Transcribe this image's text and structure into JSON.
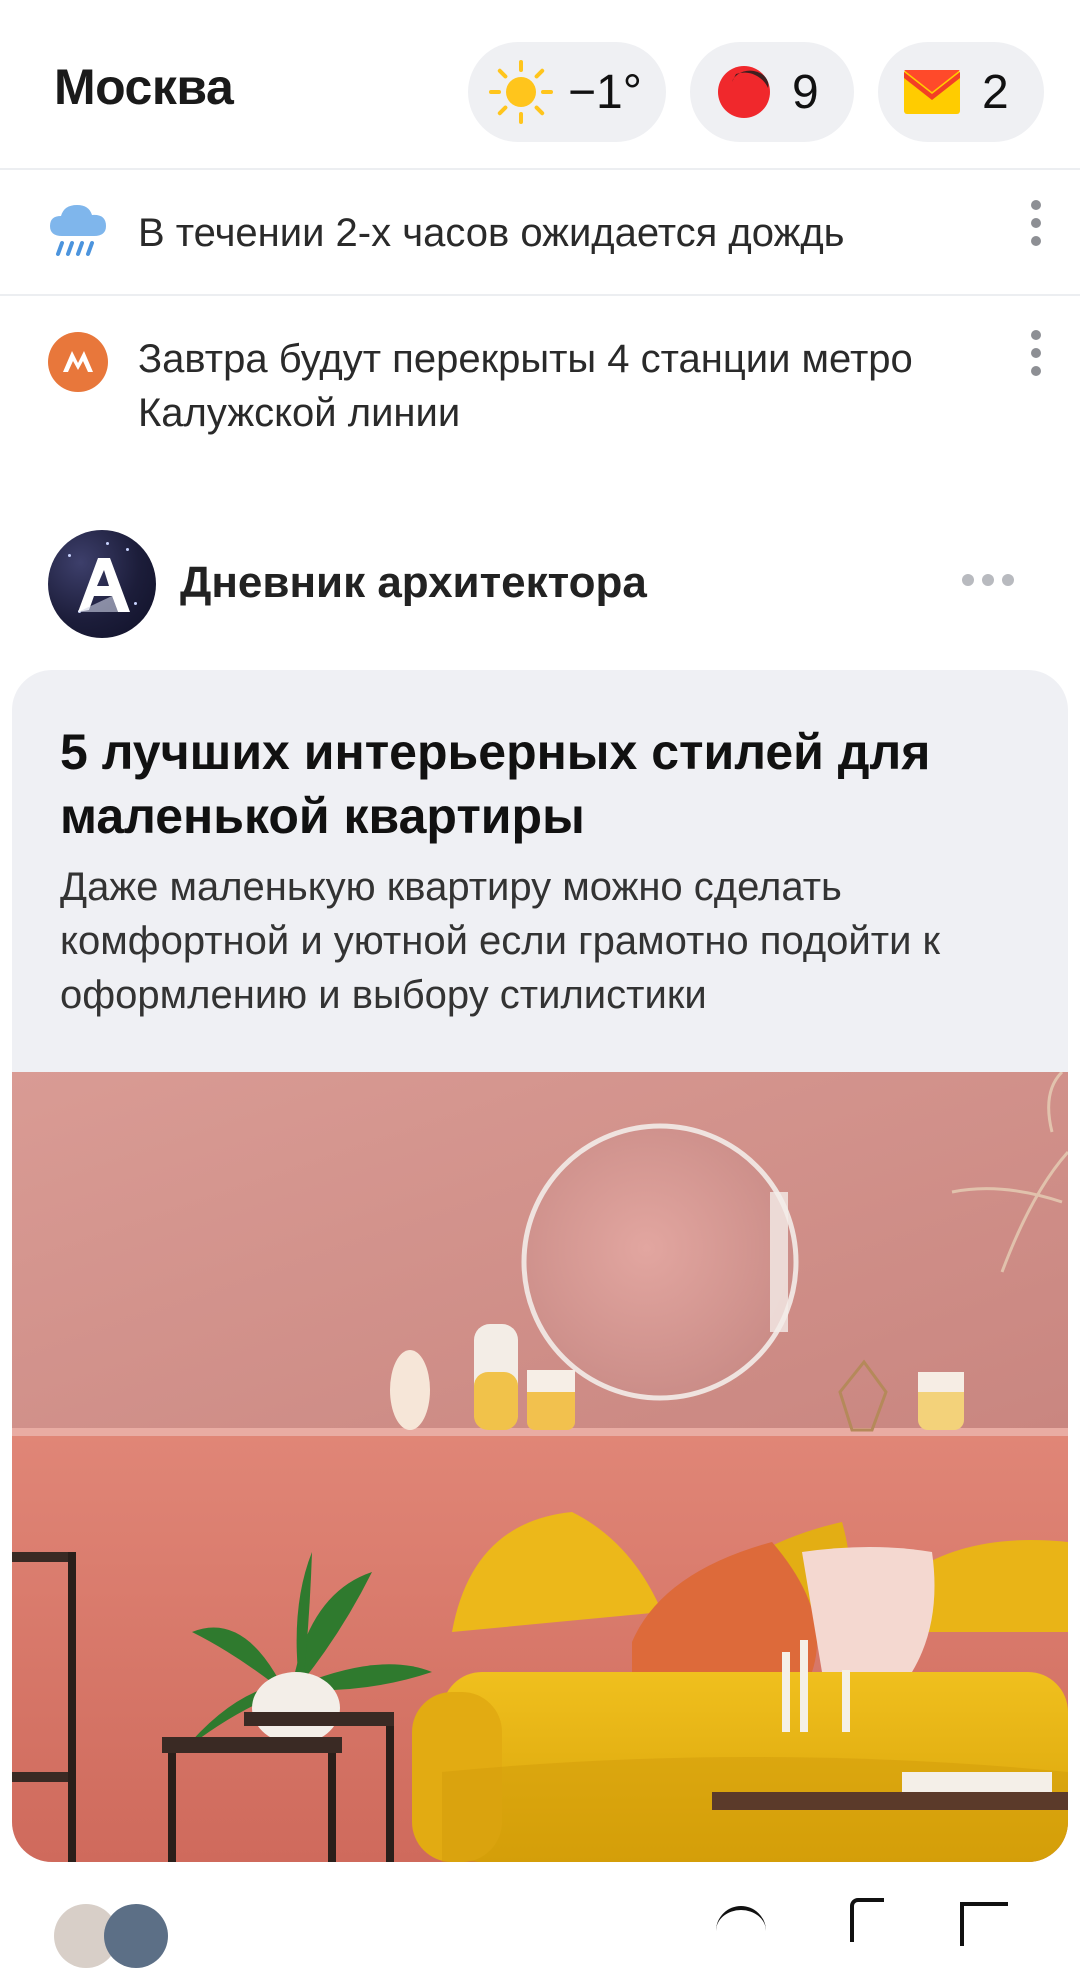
{
  "header": {
    "city": "Москва",
    "weather": {
      "icon": "sun-icon",
      "temperature": "−1°"
    },
    "traffic": {
      "icon": "traffic-light-icon",
      "score": "9",
      "color": "#f0282c"
    },
    "mail": {
      "icon": "mail-icon",
      "count": "2",
      "color": "#ffcc00"
    }
  },
  "notices": [
    {
      "icon": "rain-cloud-icon",
      "text": "В течении 2-х часов ожидается дождь"
    },
    {
      "icon": "metro-icon",
      "text": "Завтра будут перекрыты 4 станции метро Калужской линии",
      "color": "#e8773b"
    }
  ],
  "channel": {
    "avatar_letter": "A",
    "name": "Дневник архитектора"
  },
  "card": {
    "title": "5 лучших интерьерных стилей для маленькой квартиры",
    "description": "Даже маленькую квартиру можно сделать комфортной и уютной если грамотно подойти к оформлению и выбору стилистики",
    "image": "interior-photo"
  }
}
